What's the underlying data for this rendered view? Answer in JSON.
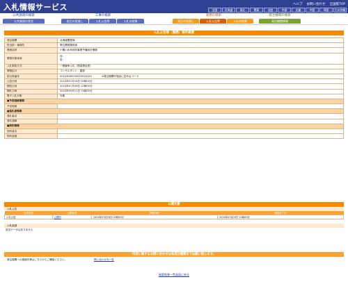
{
  "header": {
    "app_title": "入札情報サービス",
    "top_links": [
      "ヘルプ",
      "お問い合わせ",
      "全国版TOP"
    ],
    "regions": [
      "全国",
      "北海道",
      "東北",
      "関東",
      "北陸",
      "中部",
      "近畿",
      "中国",
      "四国",
      "九州沖縄"
    ]
  },
  "categories": [
    {
      "title": "公共調達の検索",
      "tabs": [
        "公共調達の状況"
      ]
    },
    {
      "title": "工事の検索",
      "tabs": [
        "発注の見通し",
        "入札公告等",
        "入札の結果"
      ]
    },
    {
      "title": "業務の検索",
      "tabs": [
        "発注の見通し",
        "入札公告等",
        "入札の結果"
      ]
    },
    {
      "title": "発注機関の検索",
      "tabs": [
        "発注機関情報"
      ]
    }
  ],
  "detail_title": "入札公告等（業務）案件概要",
  "detail_rows": [
    {
      "k": "発注機関",
      "v": "北海道開発局"
    },
    {
      "k": "担当部・事務所",
      "v": "帯広開発建設部"
    },
    {
      "k": "業務名称",
      "v": "十勝川水系砂防事業予備設計業務"
    },
    {
      "k": "業務対象地域",
      "v": "自：\n至："
    },
    {
      "k": "入札契約方式",
      "v": "一般競争入札（簡易提出型）"
    },
    {
      "k": "業務区分",
      "v": "コンサルタント　建設"
    },
    {
      "k": "設計書番号",
      "v": "00103000030029230194　　　　※発注機関が独自に定めるコード"
    },
    {
      "k": "公告日時",
      "v": "2023年07月18日 00時00分"
    },
    {
      "k": "閲覧日時",
      "v": "2023年07月26日 12時00分"
    },
    {
      "k": "開札日時",
      "v": "2023年09月11日 15時00分"
    },
    {
      "k": "電子入札対象",
      "v": "対象"
    }
  ],
  "section_rows": [
    {
      "sec": "■予定価格情報",
      "items": [
        {
          "k": "予定価格",
          "v": ""
        }
      ]
    },
    {
      "sec": "■落札者情報",
      "items": [
        {
          "k": "落札者名",
          "v": ""
        },
        {
          "k": "落札価格",
          "v": ""
        }
      ]
    },
    {
      "sec": "■契約情報",
      "items": [
        {
          "k": "契約者名",
          "v": ""
        },
        {
          "k": "契約金額",
          "v": ""
        }
      ]
    }
  ],
  "public_docs": {
    "title": "公開文書",
    "sub": "入札公告",
    "columns": [
      "文書名称",
      "公開状況",
      "掲載日時",
      "閲覧終了日"
    ],
    "rows": [
      {
        "name": "入札公告",
        "status": "公開中",
        "start": "2023年07月18日 00時00分",
        "end": "2023年07月26日 12時00分"
      }
    ]
  },
  "result": {
    "sub": "入札経過",
    "text": "該当データはありません"
  },
  "inquiry": {
    "bar": "内容に関するお問い合わせは各発注機関までお願い致します。",
    "text": "発注機関への連絡先等はこちらからご確認ください。",
    "link": "問い合わせ先一覧"
  },
  "back_link": "検索結果一覧画面に戻る"
}
